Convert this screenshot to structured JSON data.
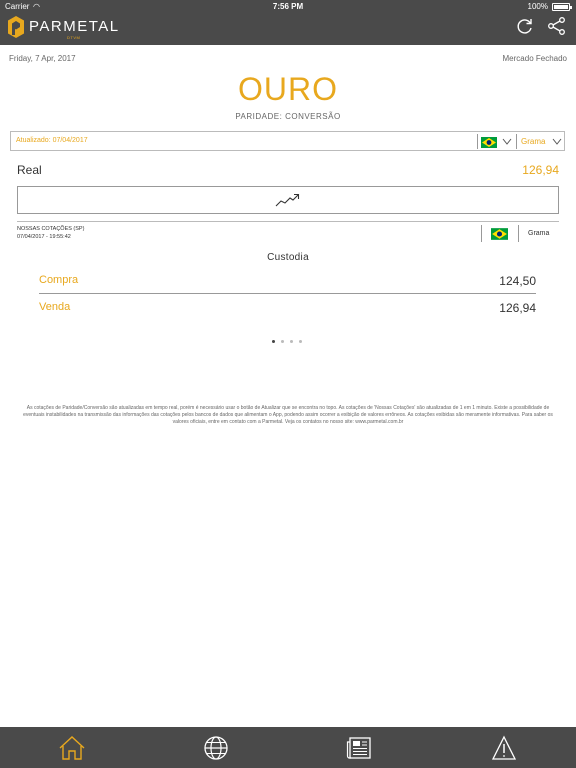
{
  "status_bar": {
    "carrier": "Carrier",
    "time": "7:56 PM",
    "battery": "100%"
  },
  "header": {
    "brand": "PARMETAL",
    "brand_sub": "DTVM",
    "accent_color": "#e8a81e",
    "bg_color": "#4a4a4a",
    "icons": [
      "refresh-icon",
      "share-icon"
    ]
  },
  "info": {
    "date": "Friday, 7 Apr, 2017",
    "market_status": "Mercado Fechado"
  },
  "main": {
    "title": "OURO",
    "subtitle": "PARIDADE: CONVERSÃO",
    "filter": {
      "updated": "Atualizado: 07/04/2017",
      "unit": "Grama"
    },
    "real": {
      "label": "Real",
      "value": "126,94"
    },
    "quotes": {
      "label": "NOSSAS COTAÇÕES (SP)",
      "timestamp": "07/04/2017 - 19:55:42",
      "unit": "Grama"
    },
    "section_title": "Custodia",
    "rows": [
      {
        "label": "Compra",
        "value": "124,50"
      },
      {
        "label": "Venda",
        "value": "126,94"
      }
    ],
    "pager": {
      "total": 4,
      "active": 1
    }
  },
  "disclaimer": "As cotações de Paridade/Conversão são atualizadas em tempo real, porém é necessário usar o botão de Atualizar que se encontra no topo. As cotações de 'Nossas Cotações' são atualizadas de 1 em 1 minuto. Existe a possibilidade de eventuais instabilidades na transmissão das informações das cotações pelos bancos de dados que alimentam o App, podendo assim ocorrer a exibição de valores errôneos. As cotações exibidas são meramente informativas. Para saber os valores oficiais, entre em contato com a Parmetal. Veja os contatos no nosso site: www.parmetal.com.br",
  "tabbar": {
    "items": [
      "home-icon",
      "globe-icon",
      "news-icon",
      "alert-icon"
    ],
    "active": "home-icon"
  }
}
